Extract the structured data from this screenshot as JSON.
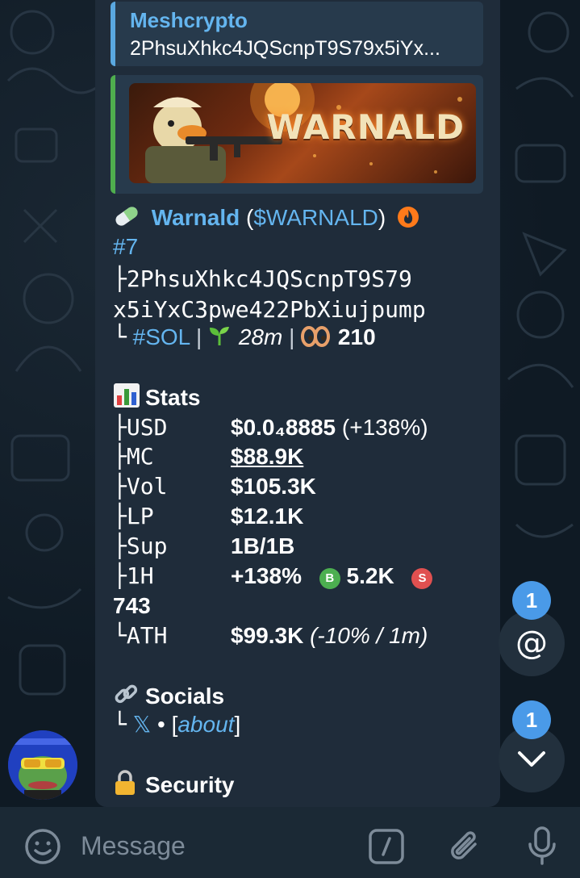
{
  "reply": {
    "name": "Meshcrypto",
    "text": "2PhsuXhkc4JQScnpT9S79x5iYx..."
  },
  "preview": {
    "banner_text": "WARNALD"
  },
  "token": {
    "pill_icon": "pill-emoji",
    "name": "Warnald",
    "ticker_open": " (",
    "ticker": "$WARNALD",
    "ticker_close": ")",
    "fire_icon": "fire-icon",
    "rank": "#7",
    "address_line1": "├2PhsuXhkc4JQScnpT9S79",
    "address_line2": "x5iYxC3pwe422PbXiujpump",
    "chain_prefix": "└",
    "chain": "#SOL",
    "sep": "|",
    "age_icon": "seedling-emoji",
    "age": "28m",
    "views_icon": "eyes-emoji",
    "views": "210"
  },
  "stats": {
    "icon": "chart-emoji",
    "title": "Stats",
    "rows": [
      {
        "prefix": "├",
        "key": "USD",
        "value": "$0.0₄8885",
        "extra": " (+138%)"
      },
      {
        "prefix": "├",
        "key": "MC",
        "value": "$88.9K",
        "extra": ""
      },
      {
        "prefix": "├",
        "key": "Vol",
        "value": "$105.3K",
        "extra": ""
      },
      {
        "prefix": "├",
        "key": "LP",
        "value": "$12.1K",
        "extra": ""
      },
      {
        "prefix": "├",
        "key": "Sup",
        "value": "1B/1B",
        "extra": ""
      }
    ],
    "hour": {
      "prefix": "├",
      "key": "1H",
      "change": "+138%",
      "buy_icon": "B",
      "buys": "5.2K",
      "sell_icon": "S",
      "sells": "743"
    },
    "ath": {
      "prefix": "└",
      "key": "ATH",
      "value": "$99.3K",
      "extra": "(-10% / 1m)"
    }
  },
  "socials": {
    "icon": "link-emoji",
    "title": "Socials",
    "prefix": "└",
    "x": "𝕏",
    "dot": " • ",
    "about_open": "[",
    "about": "about",
    "about_close": "]"
  },
  "security": {
    "icon": "lock-emoji",
    "title": "Security"
  },
  "mentions": {
    "count": "1"
  },
  "scroll_down": {
    "count": "1"
  },
  "composer": {
    "placeholder": "Message"
  },
  "colors": {
    "accent": "#64b5ef",
    "bubble": "#1f2c3a",
    "badge": "#4a9ae8",
    "buy": "#4caf50",
    "sell": "#e05050",
    "fire": "#ff7a1a"
  }
}
